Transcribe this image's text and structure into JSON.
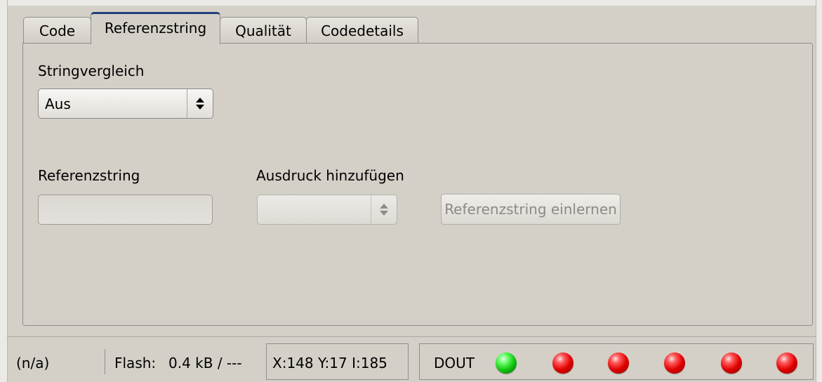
{
  "tabs": [
    {
      "label": "Code",
      "active": false
    },
    {
      "label": "Referenzstring",
      "active": true
    },
    {
      "label": "Qualität",
      "active": false
    },
    {
      "label": "Codedetails",
      "active": false
    }
  ],
  "string_compare": {
    "label": "Stringvergleich",
    "value": "Aus"
  },
  "reference": {
    "label": "Referenzstring",
    "value": ""
  },
  "add_expression": {
    "label": "Ausdruck hinzufügen",
    "value": ""
  },
  "teach_button": {
    "label": "Referenzstring einlernen",
    "enabled": false
  },
  "status": {
    "state": "(n/a)",
    "flash_label": "Flash:",
    "flash_value": "0.4 kB / ---",
    "coords": "X:148 Y:17 I:185",
    "dout_label": "DOUT",
    "leds": [
      "green",
      "red",
      "red",
      "red",
      "red",
      "red"
    ]
  },
  "colors": {
    "window_bg": "#d4d0c8",
    "active_tab_accent": "#1f3f7a",
    "led_on": "#12c812",
    "led_off": "#e00000"
  }
}
